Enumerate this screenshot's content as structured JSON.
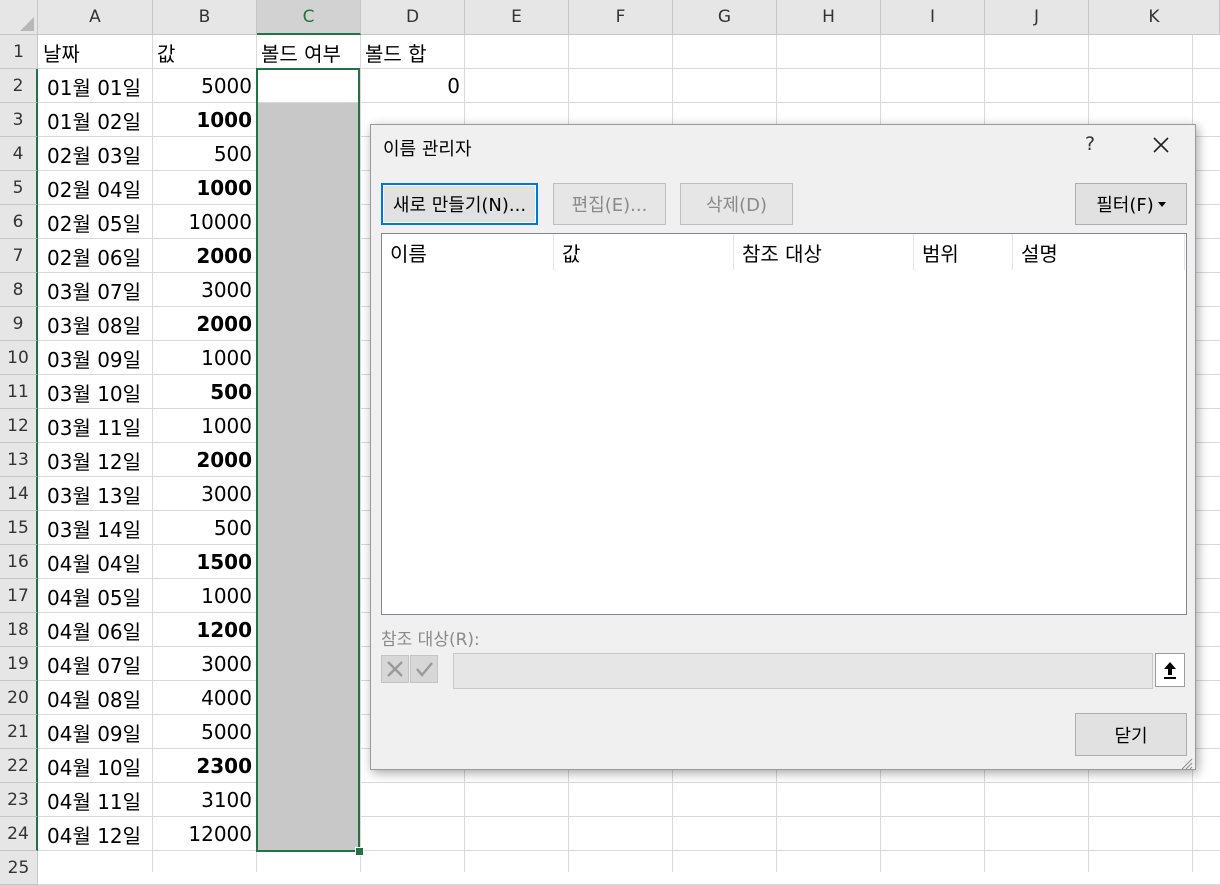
{
  "columns": [
    "A",
    "B",
    "C",
    "D",
    "E",
    "F",
    "G",
    "H",
    "I",
    "J",
    "K"
  ],
  "selected_column": "C",
  "row_numbers": [
    "1",
    "2",
    "3",
    "4",
    "5",
    "6",
    "7",
    "8",
    "9",
    "10",
    "11",
    "12",
    "13",
    "14",
    "15",
    "16",
    "17",
    "18",
    "19",
    "20",
    "21",
    "22",
    "23",
    "24",
    "25"
  ],
  "headers": {
    "a1": "날짜",
    "b1": "값",
    "c1": "볼드 여부",
    "d1": "볼드 합"
  },
  "d2": "0",
  "rows": [
    {
      "date": "01월 01일",
      "value": "5000",
      "bold": false
    },
    {
      "date": "01월 02일",
      "value": "1000",
      "bold": true
    },
    {
      "date": "02월 03일",
      "value": "500",
      "bold": false
    },
    {
      "date": "02월 04일",
      "value": "1000",
      "bold": true
    },
    {
      "date": "02월 05일",
      "value": "10000",
      "bold": false
    },
    {
      "date": "02월 06일",
      "value": "2000",
      "bold": true
    },
    {
      "date": "03월 07일",
      "value": "3000",
      "bold": false
    },
    {
      "date": "03월 08일",
      "value": "2000",
      "bold": true
    },
    {
      "date": "03월 09일",
      "value": "1000",
      "bold": false
    },
    {
      "date": "03월 10일",
      "value": "500",
      "bold": true
    },
    {
      "date": "03월 11일",
      "value": "1000",
      "bold": false
    },
    {
      "date": "03월 12일",
      "value": "2000",
      "bold": true
    },
    {
      "date": "03월 13일",
      "value": "3000",
      "bold": false
    },
    {
      "date": "03월 14일",
      "value": "500",
      "bold": false
    },
    {
      "date": "04월 04일",
      "value": "1500",
      "bold": true
    },
    {
      "date": "04월 05일",
      "value": "1000",
      "bold": false
    },
    {
      "date": "04월 06일",
      "value": "1200",
      "bold": true
    },
    {
      "date": "04월 07일",
      "value": "3000",
      "bold": false
    },
    {
      "date": "04월 08일",
      "value": "4000",
      "bold": false
    },
    {
      "date": "04월 09일",
      "value": "5000",
      "bold": false
    },
    {
      "date": "04월 10일",
      "value": "2300",
      "bold": true
    },
    {
      "date": "04월 11일",
      "value": "3100",
      "bold": false
    },
    {
      "date": "04월 12일",
      "value": "12000",
      "bold": false
    }
  ],
  "dialog": {
    "title": "이름 관리자",
    "help": "?",
    "new_button": "새로 만들기(N)...",
    "edit_button": "편집(E)...",
    "delete_button": "삭제(D)",
    "filter_button": "필터(F)",
    "list_columns": [
      "이름",
      "값",
      "참조 대상",
      "범위",
      "설명"
    ],
    "refers_to_label": "참조 대상(R):",
    "refers_to_value": "",
    "close_button": "닫기"
  },
  "colors": {
    "accent": "#217346",
    "selection_fill": "#c8c8c8",
    "focus_border": "#0078d7"
  }
}
